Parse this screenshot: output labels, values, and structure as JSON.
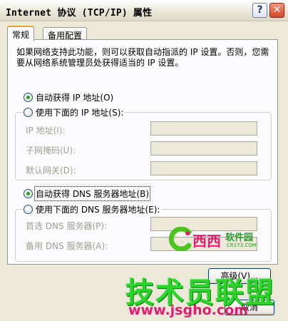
{
  "window": {
    "title": "Internet 协议 (TCP/IP) 属性",
    "help_label": "?",
    "close_label": "✕"
  },
  "tabs": [
    {
      "label": "常规",
      "active": true
    },
    {
      "label": "备用配置",
      "active": false
    }
  ],
  "intro_text": "如果网络支持此功能，则可以获取自动指派的 IP 设置。否则，您需要从网络系统管理员处获得适当的 IP 设置。",
  "ip_section": {
    "auto_label": "自动获得 IP 地址(O)",
    "manual_label": "使用下面的 IP 地址(S):",
    "selected": "auto",
    "fields": [
      {
        "label": "IP 地址(I):",
        "value": ""
      },
      {
        "label": "子网掩码(U):",
        "value": ""
      },
      {
        "label": "默认网关(D):",
        "value": ""
      }
    ]
  },
  "dns_section": {
    "auto_label": "自动获得 DNS 服务器地址(B)",
    "manual_label": "使用下面的 DNS 服务器地址(E):",
    "selected": "auto",
    "fields": [
      {
        "label": "首选 DNS 服务器(P):",
        "value": ""
      },
      {
        "label": "备用 DNS 服务器(A):",
        "value": ""
      }
    ]
  },
  "buttons": {
    "advanced": "高级(V)...",
    "cancel": "取消"
  },
  "watermarks": {
    "logo_mark": "西西",
    "logo_cn": "软件园",
    "logo_sub": "CR173.COM",
    "big_text": "技术员联盟",
    "url": "www.jsgho.com"
  },
  "colors": {
    "dialog_bg": "#ece9d8",
    "panel_bg": "#fcfcfe",
    "tab_accent": "#e6a23c",
    "radio_dot": "#21a121",
    "watermark_green": "#2bd32b",
    "watermark_pink": "#e21d72"
  }
}
